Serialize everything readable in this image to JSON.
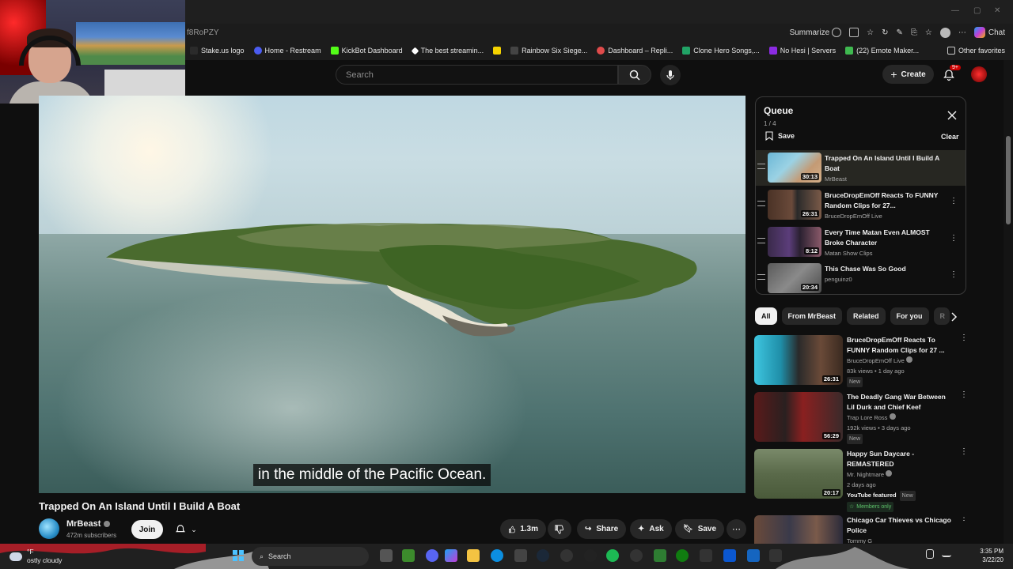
{
  "browser": {
    "url": "f8RoPZY",
    "summarize_label": "Summarize",
    "chat_label": "Chat",
    "bookmarks": [
      {
        "label": "Stake.us logo",
        "color": "#2b2b2b"
      },
      {
        "label": "Home - Restream",
        "color": "#4b5cf0"
      },
      {
        "label": "KickBot Dashboard",
        "color": "#53fc18"
      },
      {
        "label": "The best streamin...",
        "color": "#ffffff"
      },
      {
        "label": "",
        "color": "#f5d300"
      },
      {
        "label": "Rainbow Six Siege...",
        "color": "#444444"
      },
      {
        "label": "Dashboard – Repli...",
        "color": "#e04b4b"
      },
      {
        "label": "Clone Hero Songs,...",
        "color": "#21a366"
      },
      {
        "label": "No Hesi | Servers",
        "color": "#8b2be2"
      },
      {
        "label": "(22) Emote Maker...",
        "color": "#3fb950"
      }
    ],
    "other_favorites": "Other favorites"
  },
  "header": {
    "search_placeholder": "Search",
    "create_label": "Create",
    "notifications_badge": "9+"
  },
  "video": {
    "subtitle": "in the middle of the Pacific Ocean.",
    "title": "Trapped On An Island Until I Build A Boat",
    "channel": "MrBeast",
    "subscribers": "472m subscribers",
    "join_label": "Join",
    "likes": "1.3m",
    "share_label": "Share",
    "ask_label": "Ask",
    "save_label": "Save"
  },
  "queue": {
    "title": "Queue",
    "position": "1 / 4",
    "save_label": "Save",
    "clear_label": "Clear",
    "items": [
      {
        "title": "Trapped On An Island Until I Build A Boat",
        "channel": "MrBeast",
        "duration": "30:13"
      },
      {
        "title": "BruceDropEmOff Reacts To FUNNY Random Clips for 27...",
        "channel": "BruceDropEmOff Live",
        "duration": "26:31"
      },
      {
        "title": "Every Time Matan Even ALMOST Broke Character",
        "channel": "Matan Show Clips",
        "duration": "8:12"
      },
      {
        "title": "This Chase Was So Good",
        "channel": "penguinz0",
        "duration": "20:34"
      }
    ]
  },
  "chips": [
    "All",
    "From MrBeast",
    "Related",
    "For you",
    "R"
  ],
  "recommendations": [
    {
      "title": "BruceDropEmOff Reacts To FUNNY Random Clips for 27 ...",
      "channel": "BruceDropEmOff Live",
      "meta": "83k views • 1 day ago",
      "badge": "New",
      "duration": "26:31"
    },
    {
      "title": "The Deadly Gang War Between Lil Durk and Chief Keef",
      "channel": "Trap Lore Ross",
      "meta": "192k views • 3 days ago",
      "badge": "New",
      "duration": "56:29"
    },
    {
      "title": "Happy Sun Daycare - REMASTERED",
      "channel": "Mr. Nightmare",
      "meta": "2 days ago",
      "badge": "New",
      "featured": "YouTube featured",
      "members": "Members only",
      "duration": "20:17"
    },
    {
      "title": "Chicago Car Thieves vs Chicago Police",
      "channel": "Tommy G",
      "meta": "",
      "badge": "",
      "duration": ""
    }
  ],
  "taskbar": {
    "weather_temp": "°F",
    "weather_desc": "ostly cloudy",
    "search_label": "Search",
    "time": "3:35 PM",
    "date": "3/22/20"
  },
  "colors": {
    "background": "#0f0f0f",
    "accent_red": "#cc0000",
    "chip_active": "#f1f1f1"
  }
}
